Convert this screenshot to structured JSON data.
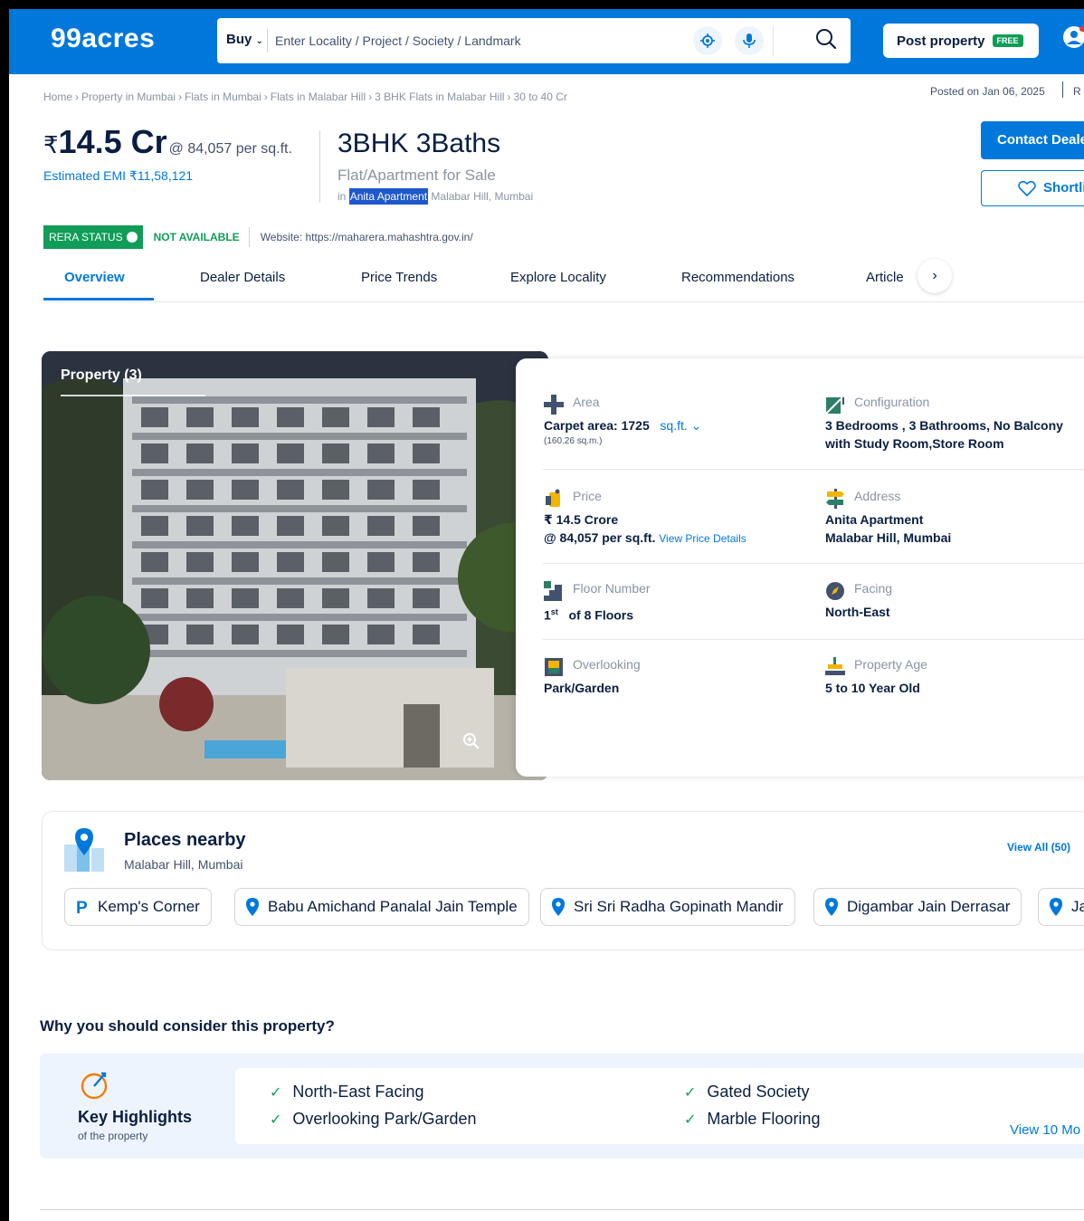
{
  "header": {
    "logo": "99acres",
    "buy_label": "Buy",
    "search_placeholder": "Enter Locality / Project / Society / Landmark",
    "post_property": "Post property",
    "free_badge": "FREE",
    "bg_color": "#0078DB"
  },
  "breadcrumb": {
    "items": [
      "Home",
      "Property in Mumbai",
      "Flats in Mumbai",
      "Flats in Malabar Hill",
      "3 BHK Flats in Malabar Hill",
      "30 to 40 Cr"
    ],
    "sep": "›"
  },
  "posted": {
    "text": "Posted on Jan 06, 2025",
    "tail": "R"
  },
  "listing": {
    "currency": "₹",
    "price": "14.5 Cr",
    "per_sqft": "@ 84,057 per sq.ft.",
    "emi": "Estimated EMI ₹11,58,121",
    "title": "3BHK 3Baths",
    "subtitle": "Flat/Apartment for Sale",
    "loc_prefix": "in",
    "loc_highlight": "Anita Apartment",
    "loc_rest": "Malabar Hill, Mumbai"
  },
  "actions": {
    "contact": "Contact Dealer",
    "shortlist": "Shortlist"
  },
  "rera": {
    "badge": "RERA STATUS",
    "status": "NOT AVAILABLE",
    "website": "Website: https://maharera.mahashtra.gov.in/"
  },
  "tabs": [
    "Overview",
    "Dealer Details",
    "Price Trends",
    "Explore Locality",
    "Recommendations",
    "Article"
  ],
  "photo": {
    "label": "Property (3)"
  },
  "details": {
    "area": {
      "label": "Area",
      "value": "Carpet area: 1725",
      "unit": "sq.ft.",
      "sub": "(160.26 sq.m.)"
    },
    "configuration": {
      "label": "Configuration",
      "line1": "3 Bedrooms , 3 Bathrooms, No Balcony",
      "line2": "with Study Room,Store Room"
    },
    "price": {
      "label": "Price",
      "line1": "₹ 14.5 Crore",
      "line2": "@ 84,057 per sq.ft.",
      "link": "View Price Details"
    },
    "address": {
      "label": "Address",
      "line1": "Anita Apartment",
      "line2": "Malabar Hill, Mumbai"
    },
    "floor": {
      "label": "Floor Number",
      "sup": "st",
      "num": "1",
      "value": "of 8 Floors"
    },
    "facing": {
      "label": "Facing",
      "value": "North-East"
    },
    "overlooking": {
      "label": "Overlooking",
      "value": "Park/Garden"
    },
    "age": {
      "label": "Property Age",
      "value": "5 to 10 Year Old"
    }
  },
  "places": {
    "title": "Places nearby",
    "subtitle": "Malabar Hill, Mumbai",
    "view_all": "View All (50)",
    "chips": [
      "Kemp's Corner",
      "Babu Amichand Panalal Jain Temple",
      "Sri Sri Radha Gopinath Mandir",
      "Digambar Jain Derrasar",
      "Ja"
    ]
  },
  "why": {
    "title": "Why you should consider this property?",
    "hl_title": "Key Highlights",
    "hl_sub": "of the property",
    "items": [
      "North-East Facing",
      "Overlooking Park/Garden",
      "Gated Society",
      "Marble Flooring"
    ],
    "view_more": "View 10 Mo"
  }
}
